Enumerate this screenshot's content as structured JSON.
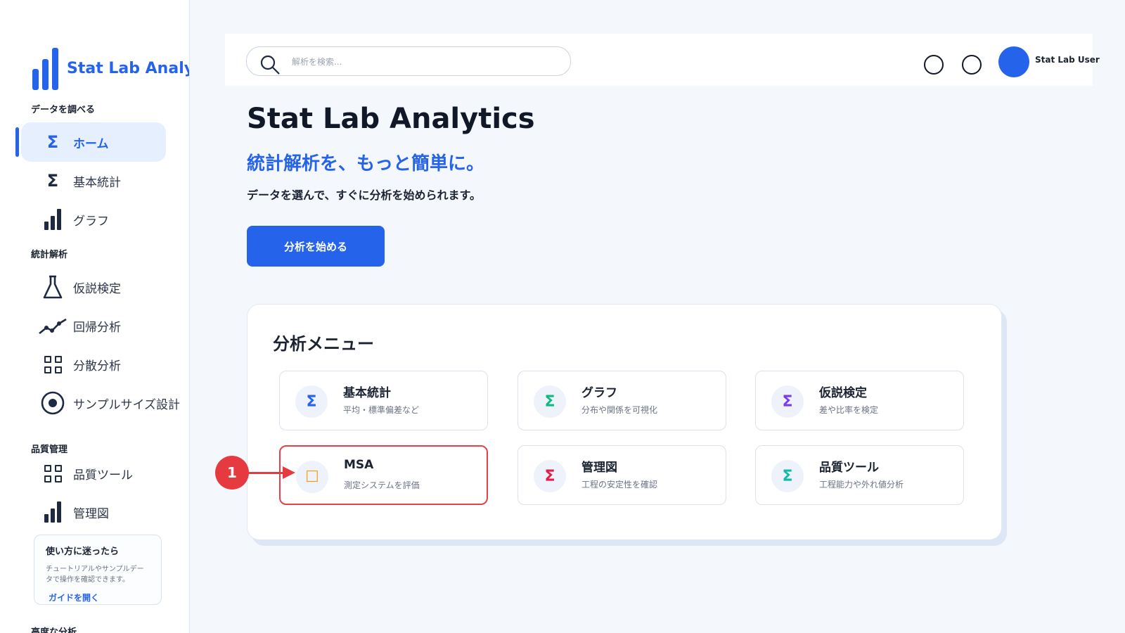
{
  "app": {
    "name": "Stat Lab Analytics"
  },
  "colors": {
    "accent": "#2563eb",
    "annotation": "#e53a3f",
    "text_dark": "#1b2333"
  },
  "sidebar": {
    "sections": [
      {
        "title": "データを調べる"
      },
      {
        "title": "統計解析"
      },
      {
        "title": "品質管理"
      },
      {
        "title": "高度な分析"
      }
    ],
    "items": [
      {
        "label": "ホーム",
        "icon": "sigma-icon",
        "active": true
      },
      {
        "label": "基本統計",
        "icon": "sigma-icon"
      },
      {
        "label": "グラフ",
        "icon": "bar-chart-icon"
      },
      {
        "label": "仮説検定",
        "icon": "flask-icon"
      },
      {
        "label": "回帰分析",
        "icon": "trend-line-icon"
      },
      {
        "label": "分散分析",
        "icon": "grid-icon"
      },
      {
        "label": "サンプルサイズ設計",
        "icon": "target-icon"
      },
      {
        "label": "品質ツール",
        "icon": "grid-icon"
      },
      {
        "label": "管理図",
        "icon": "bar-chart-icon"
      }
    ],
    "help": {
      "title": "使い方に迷ったら",
      "text": "チュートリアルやサンプルデータで操作を確認できます。",
      "link": "ガイドを開く"
    }
  },
  "header": {
    "search_placeholder": "解析を検索...",
    "user_name": "Stat Lab User"
  },
  "hero": {
    "title": "Stat Lab Analytics",
    "subtitle": "統計解析を、もっと簡単に。",
    "description": "データを選んで、すぐに分析を始められます。",
    "cta": "分析を始める"
  },
  "menu": {
    "title": "分析メニュー",
    "tiles": [
      {
        "name": "基本統計",
        "desc": "平均・標準偏差など",
        "icon": "Σ",
        "color": "#2563eb"
      },
      {
        "name": "グラフ",
        "desc": "分布や関係を可視化",
        "icon": "Σ",
        "color": "#10b981"
      },
      {
        "name": "仮説検定",
        "desc": "差や比率を検定",
        "icon": "Σ",
        "color": "#7c3aed"
      },
      {
        "name": "MSA",
        "desc": "測定システムを評価",
        "icon": "☐",
        "color": "#f59e0b"
      },
      {
        "name": "管理図",
        "desc": "工程の安定性を確認",
        "icon": "Σ",
        "color": "#e11d48"
      },
      {
        "name": "品質ツール",
        "desc": "工程能力や外れ値分析",
        "icon": "Σ",
        "color": "#14b8a6"
      }
    ]
  },
  "annotation": {
    "label": "1"
  }
}
